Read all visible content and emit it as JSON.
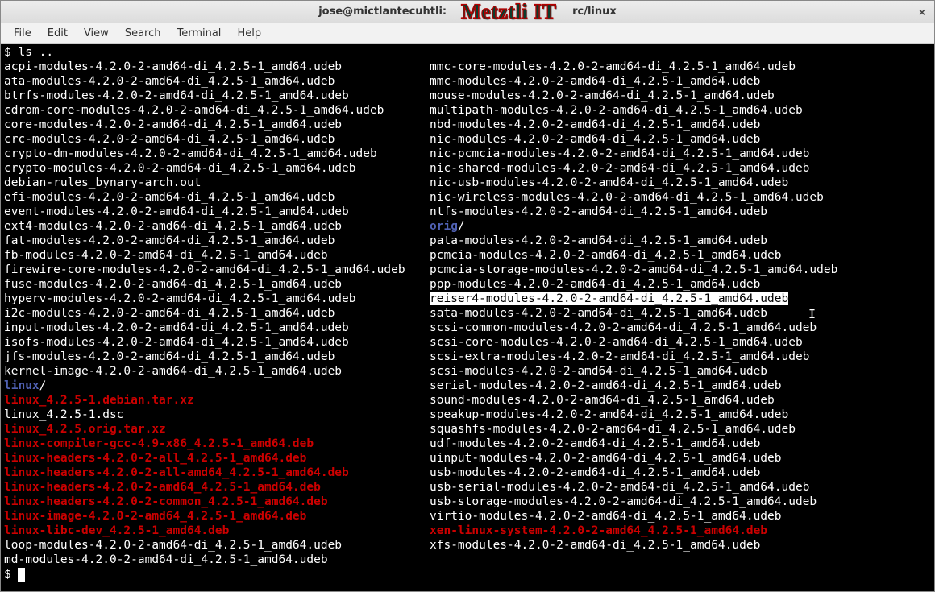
{
  "window": {
    "title_left": "jose@mictlantecuhtli:",
    "title_right": "rc/linux",
    "overlay": "Metztli IT",
    "close_glyph": "×"
  },
  "menu": {
    "items": [
      "File",
      "Edit",
      "View",
      "Search",
      "Terminal",
      "Help"
    ]
  },
  "prompt": {
    "ps": "$ ",
    "cmd": "ls ..",
    "end_ps": "$ "
  },
  "ibeam_cursor": "I",
  "left_col": [
    {
      "t": "acpi-modules-4.2.0-2-amd64-di_4.2.5-1_amd64.udeb",
      "c": "f-white"
    },
    {
      "t": "ata-modules-4.2.0-2-amd64-di_4.2.5-1_amd64.udeb",
      "c": "f-white"
    },
    {
      "t": "btrfs-modules-4.2.0-2-amd64-di_4.2.5-1_amd64.udeb",
      "c": "f-white"
    },
    {
      "t": "cdrom-core-modules-4.2.0-2-amd64-di_4.2.5-1_amd64.udeb",
      "c": "f-white"
    },
    {
      "t": "core-modules-4.2.0-2-amd64-di_4.2.5-1_amd64.udeb",
      "c": "f-white"
    },
    {
      "t": "crc-modules-4.2.0-2-amd64-di_4.2.5-1_amd64.udeb",
      "c": "f-white"
    },
    {
      "t": "crypto-dm-modules-4.2.0-2-amd64-di_4.2.5-1_amd64.udeb",
      "c": "f-white"
    },
    {
      "t": "crypto-modules-4.2.0-2-amd64-di_4.2.5-1_amd64.udeb",
      "c": "f-white"
    },
    {
      "t": "debian-rules_bynary-arch.out",
      "c": "f-white"
    },
    {
      "t": "efi-modules-4.2.0-2-amd64-di_4.2.5-1_amd64.udeb",
      "c": "f-white"
    },
    {
      "t": "event-modules-4.2.0-2-amd64-di_4.2.5-1_amd64.udeb",
      "c": "f-white"
    },
    {
      "t": "ext4-modules-4.2.0-2-amd64-di_4.2.5-1_amd64.udeb",
      "c": "f-white"
    },
    {
      "t": "fat-modules-4.2.0-2-amd64-di_4.2.5-1_amd64.udeb",
      "c": "f-white"
    },
    {
      "t": "fb-modules-4.2.0-2-amd64-di_4.2.5-1_amd64.udeb",
      "c": "f-white"
    },
    {
      "t": "firewire-core-modules-4.2.0-2-amd64-di_4.2.5-1_amd64.udeb",
      "c": "f-white"
    },
    {
      "t": "fuse-modules-4.2.0-2-amd64-di_4.2.5-1_amd64.udeb",
      "c": "f-white"
    },
    {
      "t": "hyperv-modules-4.2.0-2-amd64-di_4.2.5-1_amd64.udeb",
      "c": "f-white"
    },
    {
      "t": "i2c-modules-4.2.0-2-amd64-di_4.2.5-1_amd64.udeb",
      "c": "f-white"
    },
    {
      "t": "input-modules-4.2.0-2-amd64-di_4.2.5-1_amd64.udeb",
      "c": "f-white"
    },
    {
      "t": "isofs-modules-4.2.0-2-amd64-di_4.2.5-1_amd64.udeb",
      "c": "f-white"
    },
    {
      "t": "jfs-modules-4.2.0-2-amd64-di_4.2.5-1_amd64.udeb",
      "c": "f-white"
    },
    {
      "t": "kernel-image-4.2.0-2-amd64-di_4.2.5-1_amd64.udeb",
      "c": "f-white"
    },
    {
      "t": "linux",
      "c": "f-blue",
      "suffix": "/"
    },
    {
      "t": "linux_4.2.5-1.debian.tar.xz",
      "c": "f-red"
    },
    {
      "t": "linux_4.2.5-1.dsc",
      "c": "f-white"
    },
    {
      "t": "linux_4.2.5.orig.tar.xz",
      "c": "f-red"
    },
    {
      "t": "linux-compiler-gcc-4.9-x86_4.2.5-1_amd64.deb",
      "c": "f-red"
    },
    {
      "t": "linux-headers-4.2.0-2-all_4.2.5-1_amd64.deb",
      "c": "f-red"
    },
    {
      "t": "linux-headers-4.2.0-2-all-amd64_4.2.5-1_amd64.deb",
      "c": "f-red"
    },
    {
      "t": "linux-headers-4.2.0-2-amd64_4.2.5-1_amd64.deb",
      "c": "f-red"
    },
    {
      "t": "linux-headers-4.2.0-2-common_4.2.5-1_amd64.deb",
      "c": "f-red"
    },
    {
      "t": "linux-image-4.2.0-2-amd64_4.2.5-1_amd64.deb",
      "c": "f-red"
    },
    {
      "t": "linux-libc-dev_4.2.5-1_amd64.deb",
      "c": "f-red"
    },
    {
      "t": "loop-modules-4.2.0-2-amd64-di_4.2.5-1_amd64.udeb",
      "c": "f-white"
    },
    {
      "t": "md-modules-4.2.0-2-amd64-di_4.2.5-1_amd64.udeb",
      "c": "f-white"
    }
  ],
  "right_col": [
    {
      "t": "mmc-core-modules-4.2.0-2-amd64-di_4.2.5-1_amd64.udeb",
      "c": "f-white"
    },
    {
      "t": "mmc-modules-4.2.0-2-amd64-di_4.2.5-1_amd64.udeb",
      "c": "f-white"
    },
    {
      "t": "mouse-modules-4.2.0-2-amd64-di_4.2.5-1_amd64.udeb",
      "c": "f-white"
    },
    {
      "t": "multipath-modules-4.2.0-2-amd64-di_4.2.5-1_amd64.udeb",
      "c": "f-white"
    },
    {
      "t": "nbd-modules-4.2.0-2-amd64-di_4.2.5-1_amd64.udeb",
      "c": "f-white"
    },
    {
      "t": "nic-modules-4.2.0-2-amd64-di_4.2.5-1_amd64.udeb",
      "c": "f-white"
    },
    {
      "t": "nic-pcmcia-modules-4.2.0-2-amd64-di_4.2.5-1_amd64.udeb",
      "c": "f-white"
    },
    {
      "t": "nic-shared-modules-4.2.0-2-amd64-di_4.2.5-1_amd64.udeb",
      "c": "f-white"
    },
    {
      "t": "nic-usb-modules-4.2.0-2-amd64-di_4.2.5-1_amd64.udeb",
      "c": "f-white"
    },
    {
      "t": "nic-wireless-modules-4.2.0-2-amd64-di_4.2.5-1_amd64.udeb",
      "c": "f-white"
    },
    {
      "t": "ntfs-modules-4.2.0-2-amd64-di_4.2.5-1_amd64.udeb",
      "c": "f-white"
    },
    {
      "t": "orig",
      "c": "f-blue",
      "suffix": "/"
    },
    {
      "t": "pata-modules-4.2.0-2-amd64-di_4.2.5-1_amd64.udeb",
      "c": "f-white"
    },
    {
      "t": "pcmcia-modules-4.2.0-2-amd64-di_4.2.5-1_amd64.udeb",
      "c": "f-white"
    },
    {
      "t": "pcmcia-storage-modules-4.2.0-2-amd64-di_4.2.5-1_amd64.udeb",
      "c": "f-white"
    },
    {
      "t": "ppp-modules-4.2.0-2-amd64-di_4.2.5-1_amd64.udeb",
      "c": "f-white"
    },
    {
      "t": "reiser4-modules-4.2.0-2-amd64-di_4.2.5-1_amd64.udeb",
      "c": "f-white",
      "hl": true
    },
    {
      "t": "sata-modules-4.2.0-2-amd64-di_4.2.5-1_amd64.udeb",
      "c": "f-white"
    },
    {
      "t": "scsi-common-modules-4.2.0-2-amd64-di_4.2.5-1_amd64.udeb",
      "c": "f-white"
    },
    {
      "t": "scsi-core-modules-4.2.0-2-amd64-di_4.2.5-1_amd64.udeb",
      "c": "f-white"
    },
    {
      "t": "scsi-extra-modules-4.2.0-2-amd64-di_4.2.5-1_amd64.udeb",
      "c": "f-white"
    },
    {
      "t": "scsi-modules-4.2.0-2-amd64-di_4.2.5-1_amd64.udeb",
      "c": "f-white"
    },
    {
      "t": "serial-modules-4.2.0-2-amd64-di_4.2.5-1_amd64.udeb",
      "c": "f-white"
    },
    {
      "t": "sound-modules-4.2.0-2-amd64-di_4.2.5-1_amd64.udeb",
      "c": "f-white"
    },
    {
      "t": "speakup-modules-4.2.0-2-amd64-di_4.2.5-1_amd64.udeb",
      "c": "f-white"
    },
    {
      "t": "squashfs-modules-4.2.0-2-amd64-di_4.2.5-1_amd64.udeb",
      "c": "f-white"
    },
    {
      "t": "udf-modules-4.2.0-2-amd64-di_4.2.5-1_amd64.udeb",
      "c": "f-white"
    },
    {
      "t": "uinput-modules-4.2.0-2-amd64-di_4.2.5-1_amd64.udeb",
      "c": "f-white"
    },
    {
      "t": "usb-modules-4.2.0-2-amd64-di_4.2.5-1_amd64.udeb",
      "c": "f-white"
    },
    {
      "t": "usb-serial-modules-4.2.0-2-amd64-di_4.2.5-1_amd64.udeb",
      "c": "f-white"
    },
    {
      "t": "usb-storage-modules-4.2.0-2-amd64-di_4.2.5-1_amd64.udeb",
      "c": "f-white"
    },
    {
      "t": "virtio-modules-4.2.0-2-amd64-di_4.2.5-1_amd64.udeb",
      "c": "f-white"
    },
    {
      "t": "xen-linux-system-4.2.0-2-amd64_4.2.5-1_amd64.deb",
      "c": "f-red"
    },
    {
      "t": "xfs-modules-4.2.0-2-amd64-di_4.2.5-1_amd64.udeb",
      "c": "f-white"
    }
  ]
}
